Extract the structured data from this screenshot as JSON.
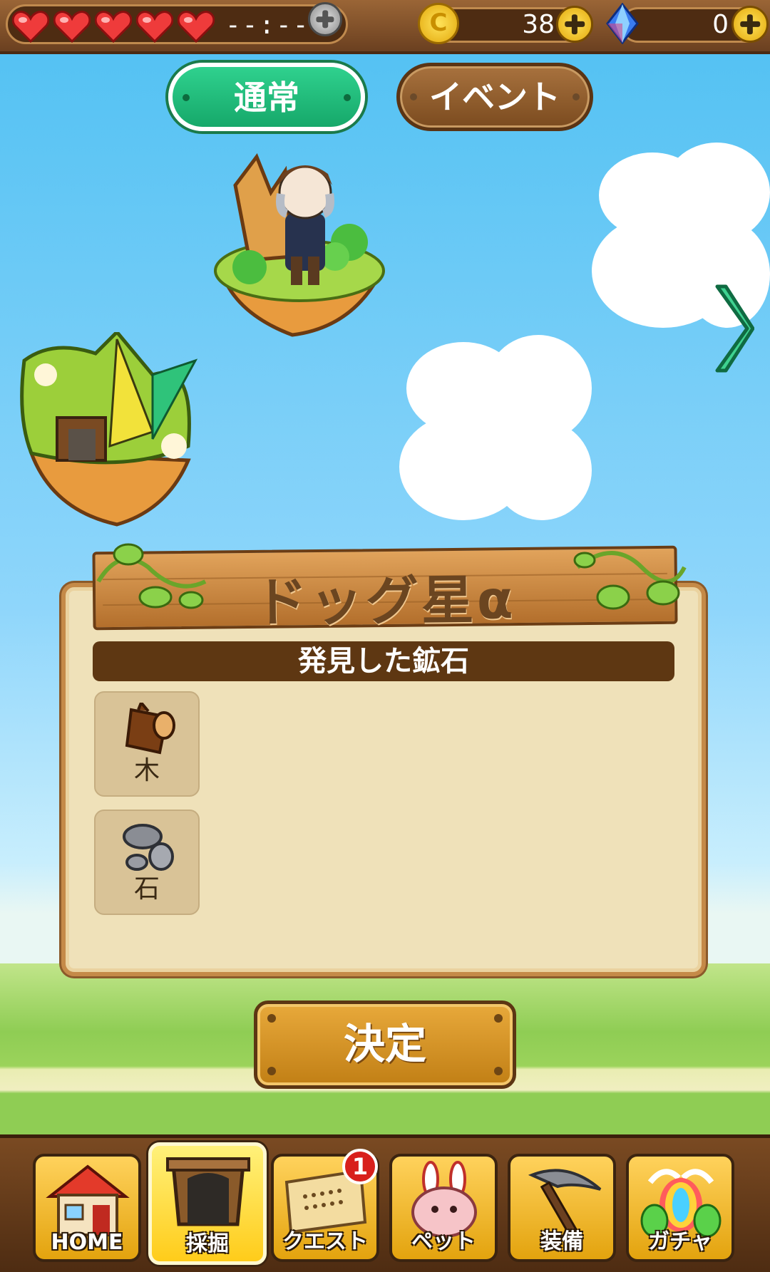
{
  "status_bar": {
    "lives_total": 5,
    "lives_filled": 5,
    "stamina_timer": "--:--",
    "coins": "38",
    "coin_symbol": "C",
    "gems": "0",
    "icons": [
      "heart-icon",
      "add-stamina-icon",
      "coin-icon",
      "add-coins-icon",
      "gem-icon",
      "add-gems-icon"
    ]
  },
  "mode_tabs": [
    {
      "label": "通常",
      "selected": true
    },
    {
      "label": "イベント",
      "selected": false
    }
  ],
  "planet": {
    "name": "ドッグ星α",
    "ore_section_title": "発見した鉱石",
    "ores": [
      {
        "label": "木",
        "icon": "wood-log-icon"
      },
      {
        "label": "石",
        "icon": "stone-icon"
      }
    ]
  },
  "confirm_button": {
    "label": "決定"
  },
  "bottom_nav": [
    {
      "label": "HOME",
      "icon": "house-icon",
      "active": false
    },
    {
      "label": "採掘",
      "icon": "mine-entrance-icon",
      "active": true
    },
    {
      "label": "クエスト",
      "icon": "quest-scroll-icon",
      "active": false,
      "badge": "1"
    },
    {
      "label": "ペット",
      "icon": "pet-rabbit-icon",
      "active": false
    },
    {
      "label": "装備",
      "icon": "pickaxe-icon",
      "active": false
    },
    {
      "label": "ガチャ",
      "icon": "gacha-egg-icon",
      "active": false
    }
  ],
  "colors": {
    "sky": "#4fc0f2",
    "selected_tab": "#1fbf7c",
    "wood": "#a8723e",
    "panel": "#efe1b9",
    "gold": "#e3a30e"
  }
}
